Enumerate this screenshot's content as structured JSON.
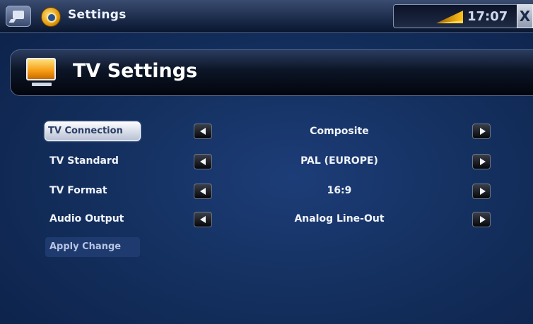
{
  "app": {
    "title": "Settings"
  },
  "status": {
    "time": "17:07",
    "close_label": "X"
  },
  "header": {
    "title": "TV Settings"
  },
  "settings": [
    {
      "label": "TV Connection",
      "value": "Composite"
    },
    {
      "label": "TV Standard",
      "value": "PAL (EUROPE)"
    },
    {
      "label": "TV Format",
      "value": "16:9"
    },
    {
      "label": "Audio Output",
      "value": "Analog Line-Out"
    }
  ],
  "actions": {
    "apply_label": "Apply Change"
  },
  "icons": {
    "menu": "menu-icon",
    "app": "settings-app-icon",
    "battery": "battery-icon",
    "tv": "tv-icon",
    "prev": "arrow-left-icon",
    "next": "arrow-right-icon"
  },
  "colors": {
    "background": "#14305f",
    "accent": "#f59a12",
    "selected_bg": "#e8ecf5"
  }
}
